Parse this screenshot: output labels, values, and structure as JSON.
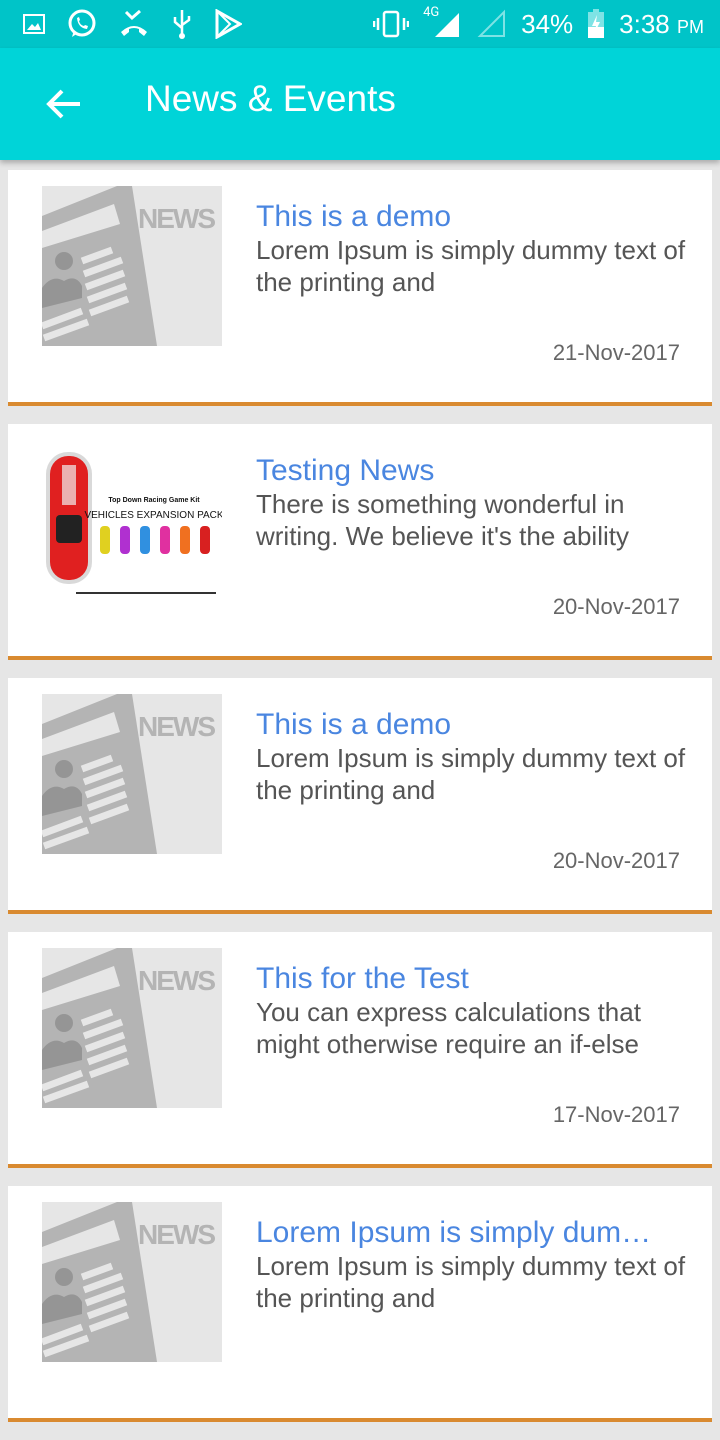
{
  "statusbar": {
    "network": "4G",
    "battery": "34%",
    "time": "3:38",
    "ampm": "PM"
  },
  "appbar": {
    "title": "News & Events"
  },
  "items": [
    {
      "title": "This is a demo",
      "desc": "Lorem Ipsum is simply dummy text of the printing and",
      "date": "21-Nov-2017",
      "thumb": "news"
    },
    {
      "title": "Testing News",
      "desc": "There is something wonderful in writing. We believe it's the ability",
      "date": "20-Nov-2017",
      "thumb": "cars",
      "thumb_title": "Top Down Racing Game Kit",
      "thumb_subtitle": "VEHICLES EXPANSION PACK"
    },
    {
      "title": "This is a demo",
      "desc": "Lorem Ipsum is simply dummy text of the printing and",
      "date": "20-Nov-2017",
      "thumb": "news"
    },
    {
      "title": "This for the Test",
      "desc": "You can express calculations that might otherwise require an if-else",
      "date": "17-Nov-2017",
      "thumb": "news"
    },
    {
      "title": "Lorem Ipsum is simply dummy text",
      "desc": "Lorem Ipsum is simply dummy text of the printing and",
      "date": "",
      "thumb": "news"
    }
  ],
  "colors": {
    "accent": "#00d4d8",
    "title": "#4a86e0",
    "divider": "#d98a30"
  }
}
